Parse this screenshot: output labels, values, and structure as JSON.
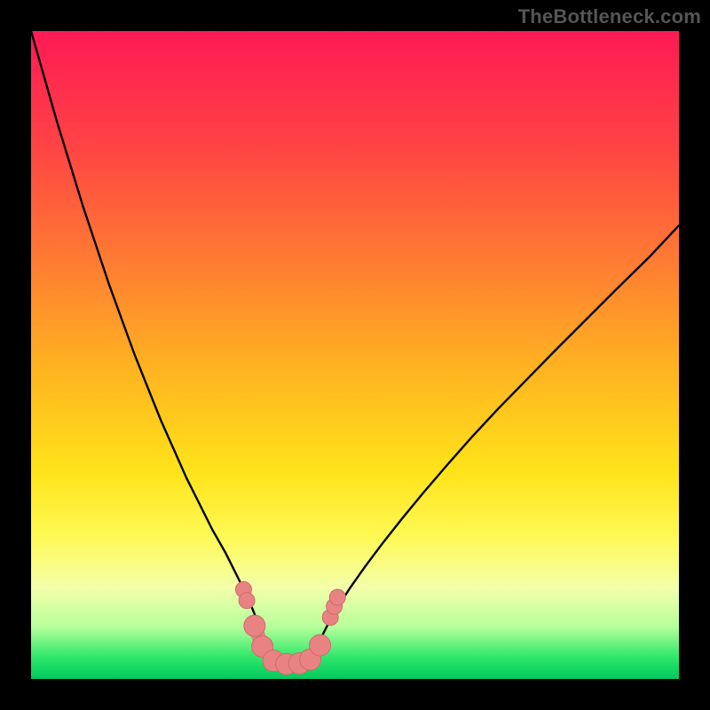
{
  "watermark": "TheBottleneck.com",
  "chart_data": {
    "type": "line",
    "title": "",
    "xlabel": "",
    "ylabel": "",
    "xlim": [
      0,
      100
    ],
    "ylim": [
      0,
      100
    ],
    "grid": false,
    "background_gradient": {
      "top_color": "#ff1a55",
      "stops": [
        {
          "pos": 0.0,
          "color": "#ff1a55"
        },
        {
          "pos": 0.18,
          "color": "#ff4444"
        },
        {
          "pos": 0.35,
          "color": "#ff7a33"
        },
        {
          "pos": 0.52,
          "color": "#ffb321"
        },
        {
          "pos": 0.68,
          "color": "#ffe31a"
        },
        {
          "pos": 0.78,
          "color": "#fff955"
        },
        {
          "pos": 0.86,
          "color": "#f3ffab"
        },
        {
          "pos": 0.92,
          "color": "#b6ff9a"
        },
        {
          "pos": 0.965,
          "color": "#32e86b"
        },
        {
          "pos": 1.0,
          "color": "#00c95f"
        }
      ]
    },
    "series": [
      {
        "name": "left-curve",
        "color": "#000000",
        "width": 2.4,
        "x": [
          0,
          2,
          4,
          6,
          8,
          10,
          12,
          14,
          16,
          18,
          20,
          22,
          24,
          26,
          28,
          30,
          32,
          33.5,
          34.5,
          35.5,
          36.3,
          36.8
        ],
        "y": [
          100,
          93,
          86,
          79.5,
          73,
          67,
          61,
          55.5,
          50,
          45,
          40,
          35.5,
          31,
          27,
          23,
          19.5,
          15.5,
          12.5,
          10,
          7.5,
          5.2,
          3.5
        ]
      },
      {
        "name": "right-curve",
        "color": "#000000",
        "width": 2.4,
        "x": [
          43.5,
          44.3,
          45.6,
          47.2,
          49.2,
          51.6,
          54.3,
          57.3,
          60.6,
          64.2,
          68,
          72,
          76.3,
          80.8,
          85.5,
          90.4,
          95.5,
          100
        ],
        "y": [
          3.5,
          5.4,
          8.0,
          10.9,
          14.0,
          17.4,
          21.0,
          24.8,
          28.8,
          33.0,
          37.3,
          41.6,
          46.0,
          50.6,
          55.3,
          60.2,
          65.2,
          70.0
        ]
      },
      {
        "name": "valley-marker",
        "type": "scatter",
        "color": "#e98383",
        "stroke": "#cc6c6c",
        "radius_small": 9,
        "radius_large": 12,
        "bridge_width": 16,
        "points": [
          {
            "x": 32.8,
            "y": 13.8,
            "r": "small"
          },
          {
            "x": 33.3,
            "y": 12.1,
            "r": "small"
          },
          {
            "x": 34.5,
            "y": 8.2,
            "r": "large"
          },
          {
            "x": 35.7,
            "y": 5.0,
            "r": "large"
          },
          {
            "x": 37.4,
            "y": 2.8,
            "r": "large"
          },
          {
            "x": 39.4,
            "y": 2.3,
            "r": "large"
          },
          {
            "x": 41.4,
            "y": 2.4,
            "r": "large"
          },
          {
            "x": 43.1,
            "y": 3.0,
            "r": "large"
          },
          {
            "x": 44.6,
            "y": 5.2,
            "r": "large"
          },
          {
            "x": 46.2,
            "y": 9.5,
            "r": "small"
          },
          {
            "x": 46.8,
            "y": 11.2,
            "r": "small"
          },
          {
            "x": 47.3,
            "y": 12.6,
            "r": "small"
          }
        ]
      }
    ]
  }
}
